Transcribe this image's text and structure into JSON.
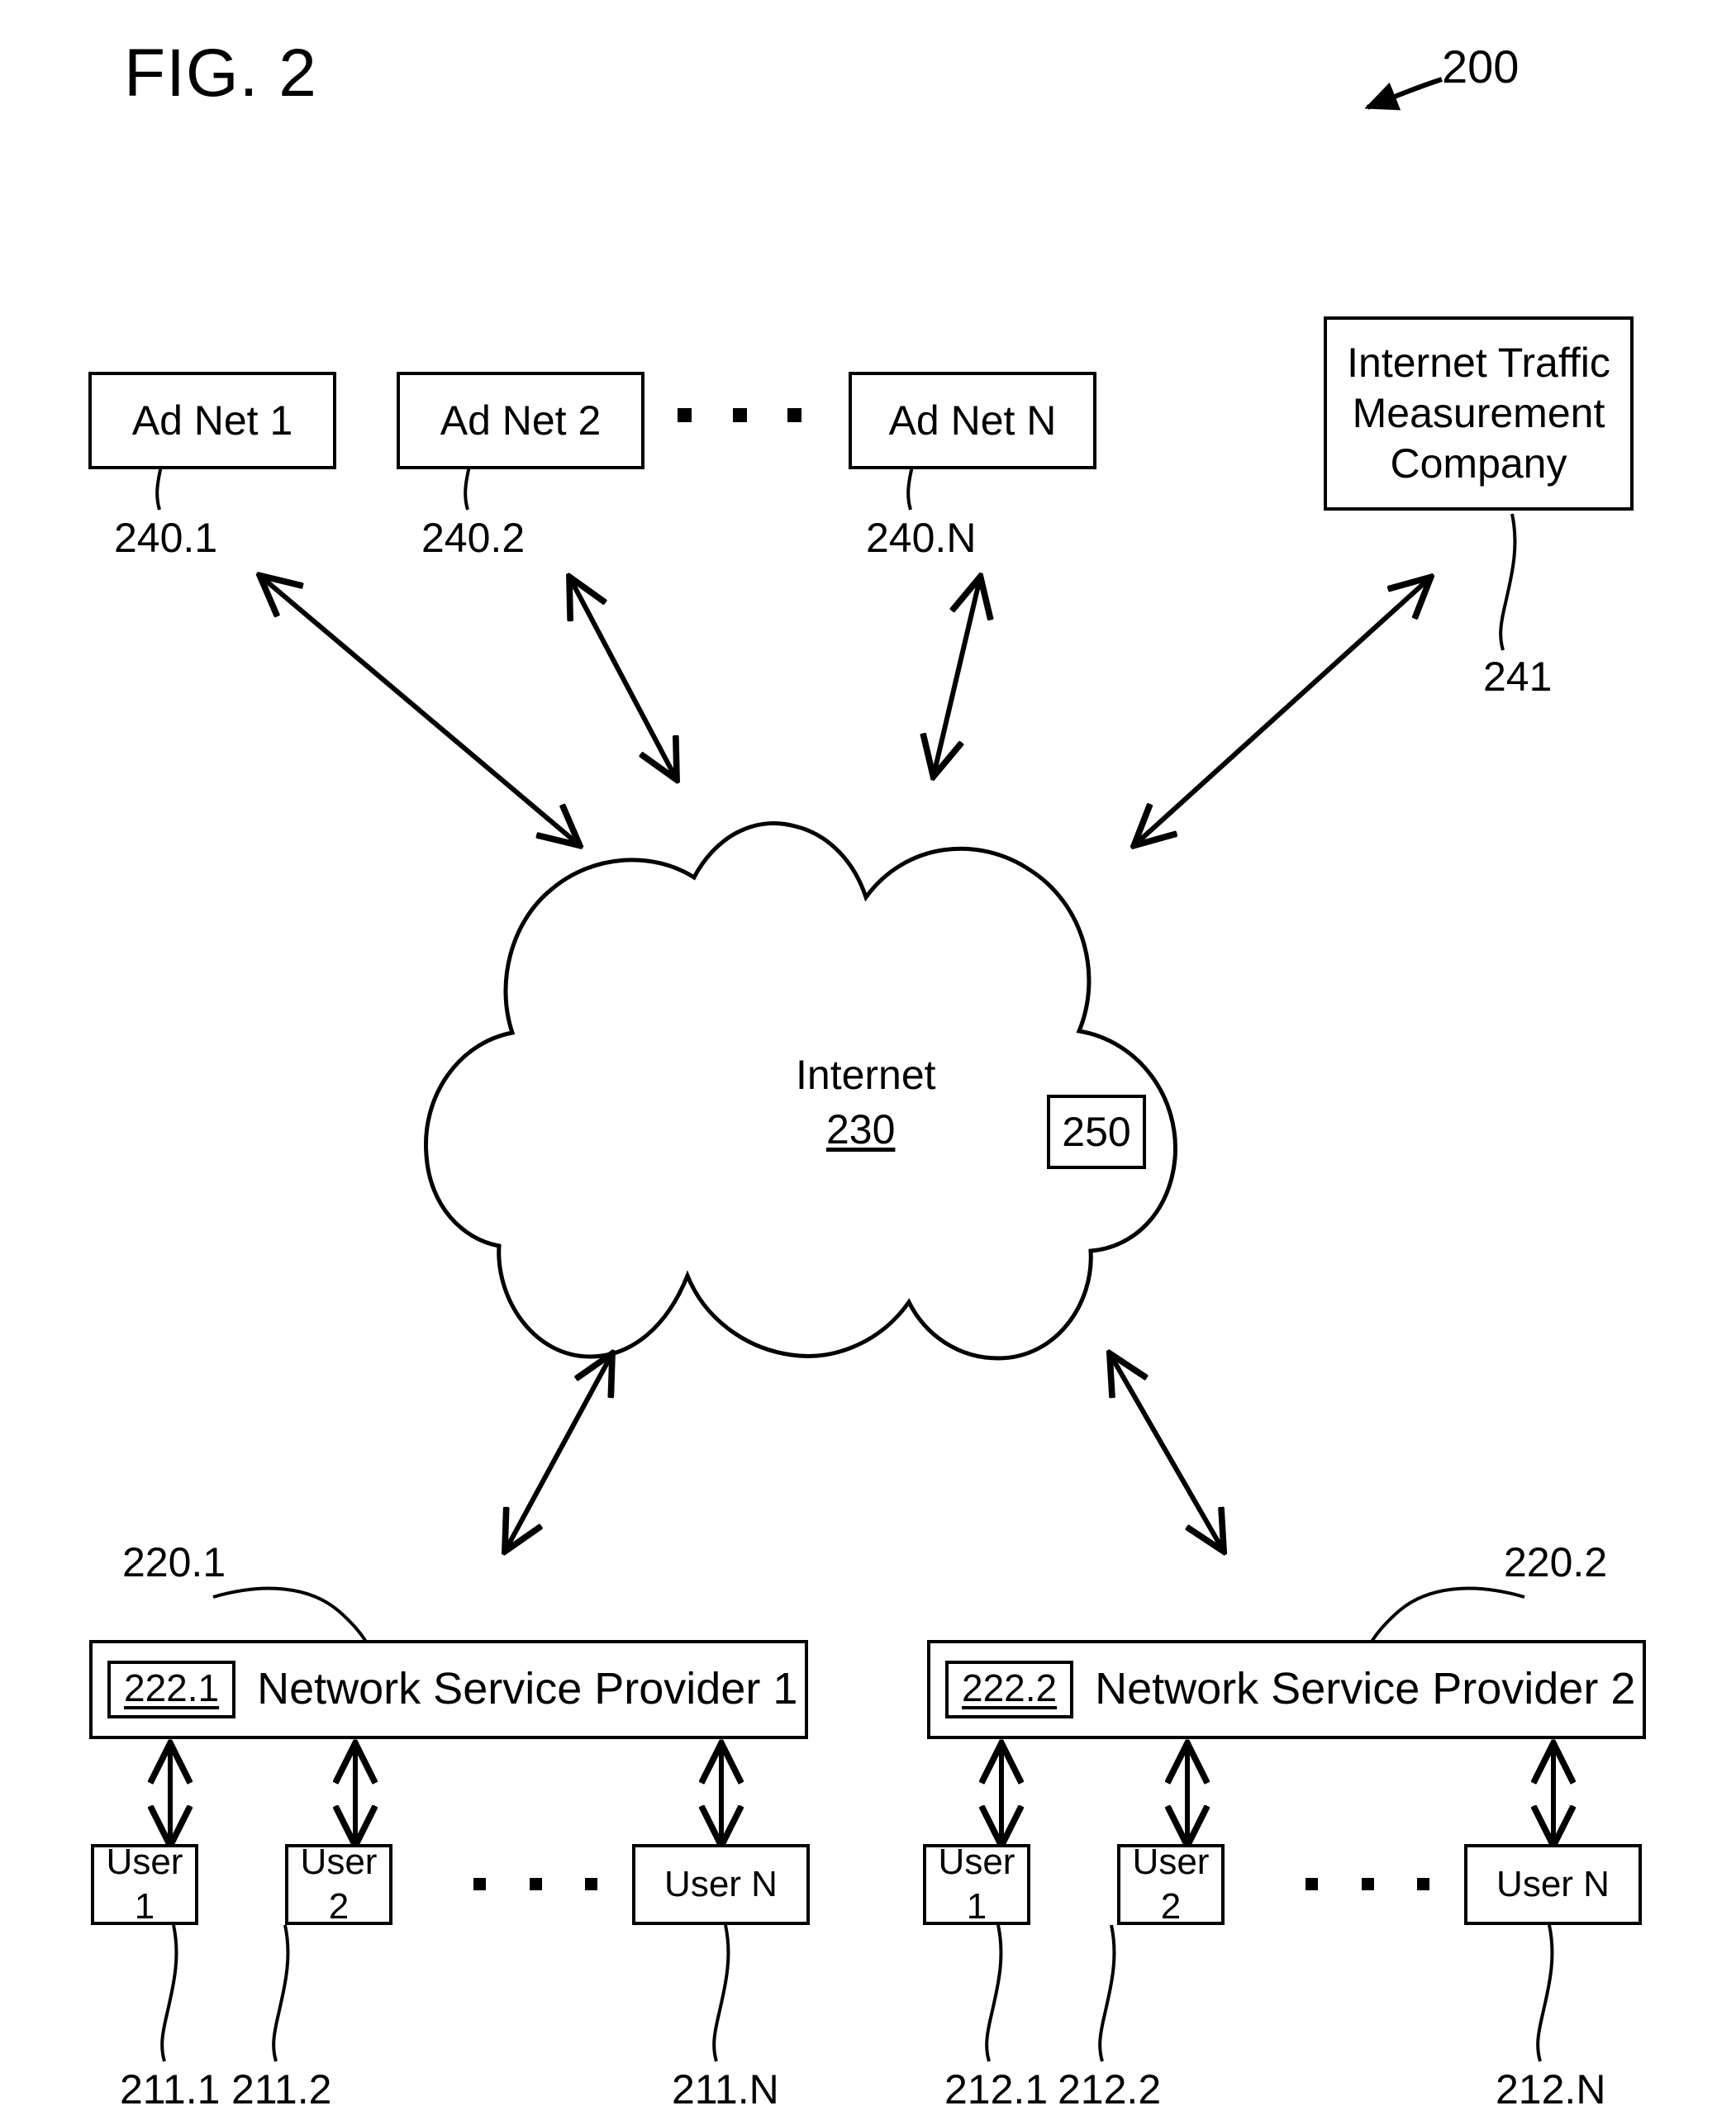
{
  "figure": {
    "title": "FIG. 2",
    "system_ref": "200"
  },
  "ad_networks": [
    {
      "label": "Ad Net 1",
      "ref": "240.1"
    },
    {
      "label": "Ad Net 2",
      "ref": "240.2"
    },
    {
      "label": "Ad Net N",
      "ref": "240.N"
    }
  ],
  "measurement_company": {
    "line1": "Internet Traffic",
    "line2": "Measurement",
    "line3": "Company",
    "ref": "241"
  },
  "cloud": {
    "label": "Internet",
    "ref": "230",
    "inner_box_ref": "250"
  },
  "providers": [
    {
      "inner_ref": "222.1",
      "label": "Network Service Provider 1",
      "ref": "220.1",
      "users": [
        {
          "label": "User 1",
          "ref": "211.1"
        },
        {
          "label": "User 2",
          "ref": "211.2"
        },
        {
          "label": "User N",
          "ref": "211.N"
        }
      ]
    },
    {
      "inner_ref": "222.2",
      "label": "Network Service Provider 2",
      "ref": "220.2",
      "users": [
        {
          "label": "User 1",
          "ref": "212.1"
        },
        {
          "label": "User 2",
          "ref": "212.2"
        },
        {
          "label": "User N",
          "ref": "212.N"
        }
      ]
    }
  ],
  "colors": {
    "ink": "#000000",
    "paper": "#ffffff"
  }
}
